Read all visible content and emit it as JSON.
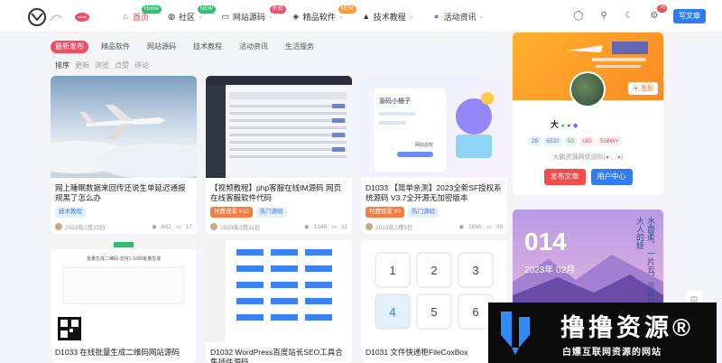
{
  "nav": {
    "items": [
      {
        "label": "首页",
        "badge": "Home",
        "badge_color": "#2fbf71",
        "icon": "home-icon",
        "active": true
      },
      {
        "label": "社区",
        "badge": "NEW",
        "badge_color": "#2fbf71",
        "icon": "community-icon",
        "caret": "⌄"
      },
      {
        "label": "网站源码",
        "badge": "折扣",
        "badge_color": "#f44b66",
        "icon": "monitor-icon",
        "caret": "⌄"
      },
      {
        "label": "精品软件",
        "badge": "NEW",
        "badge_color": "#ff9a2f",
        "icon": "android-icon",
        "caret": "⌄"
      },
      {
        "label": "技术教程",
        "icon": "mortarboard-icon",
        "caret": "⌄"
      },
      {
        "label": "活动资讯",
        "icon": "dot-icon",
        "caret": "⌄"
      }
    ],
    "notify_count": "76",
    "write_label": "写文章"
  },
  "tabs": [
    "最新发布",
    "精品软件",
    "网站源码",
    "技术教程",
    "活动资讯",
    "生活服务"
  ],
  "sorts": [
    "排序",
    "更新",
    "浏览",
    "点赞",
    "评论"
  ],
  "cards": [
    {
      "title": "网上睡眠数据来回传还说生单延迟通报规黑了怎么办",
      "tags": [
        {
          "text": "技术教程",
          "style": "blue"
        }
      ],
      "date": "2023年2月12日",
      "views": "682",
      "comments": "17"
    },
    {
      "title": "【视频教程】php客服在线IM源码 网页在线客服软件代码",
      "tags": [
        {
          "text": "付费观看 ¥10",
          "style": "orange"
        },
        {
          "text": "热门源码",
          "style": "blue"
        }
      ],
      "date": "2023年2月11日",
      "views": "1349",
      "comments": "11"
    },
    {
      "title": "D1033 【简单亲测】2023全新SF授权系统源码 V3.7全开源无加密版本",
      "tags": [
        {
          "text": "付费观看 ¥9",
          "style": "orange"
        },
        {
          "text": "热门源码",
          "style": "blue"
        }
      ],
      "date": "2023年2月9日",
      "views": "1616",
      "comments": "29"
    },
    {
      "title": "D1033 在线批量生成二维码网站源码",
      "tags": [],
      "date": "",
      "views": "",
      "comments": ""
    },
    {
      "title": "D1032 WordPress百度站长SEO工具合集插件源码",
      "tags": [],
      "date": "",
      "views": "",
      "comments": ""
    },
    {
      "title": "D1031 文件快递柜FileCoxBox",
      "tags": [],
      "date": "",
      "views": "",
      "comments": ""
    }
  ],
  "card_images": {
    "c3_title": "源码小栅子",
    "c3_sub": "网站授权",
    "c4_heading": "批量生成二维码-支持1-1000批量生成",
    "keypad": [
      "1",
      "2",
      "3",
      "4",
      "5",
      "6"
    ]
  },
  "profile": {
    "name": "大",
    "stats": [
      {
        "text": "25",
        "bg": "#e7f0ff",
        "fg": "#2f7cf6"
      },
      {
        "text": "6522",
        "bg": "#e8f3ff",
        "fg": "#2f7cf6"
      },
      {
        "text": "50",
        "bg": "#e8f8ee",
        "fg": "#2fbf71"
      },
      {
        "text": "185",
        "bg": "#ffeef0",
        "fg": "#f44b66"
      },
      {
        "text": "556W+",
        "bg": "#ffeef0",
        "fg": "#f44b66"
      }
    ],
    "desc": "大鹏资源网欢迎你(●'◡'●)",
    "sign_label": "签到",
    "btn_publish": "发布文章",
    "btn_center": "用户中心"
  },
  "calendar": {
    "num": "014",
    "date": "2023年 02月",
    "poem": "水面柔，一片云，元宵节大人的娃"
  },
  "watermark": {
    "title": "撸撸资源®",
    "subtitle": "白嫖互联网资源的网站"
  }
}
